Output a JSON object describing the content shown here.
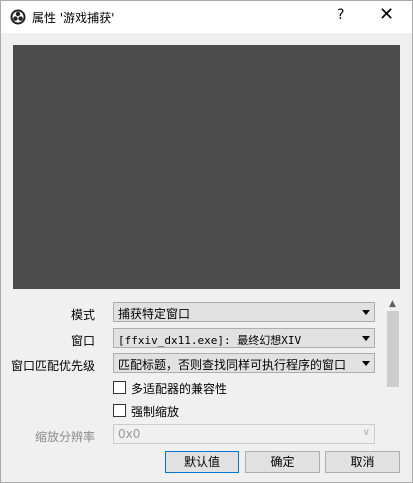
{
  "window": {
    "title": "属性 '游戏捕获'",
    "help_symbol": "?",
    "close_symbol": "✕",
    "icon": "obs-logo-icon"
  },
  "properties": {
    "mode": {
      "label": "模式",
      "value": "捕获特定窗口"
    },
    "window": {
      "label": "窗口",
      "value": "[ffxiv_dx11.exe]: 最终幻想XIV"
    },
    "match_priority": {
      "label": "窗口匹配优先级",
      "value": "匹配标题，否则查找同样可执行程序的窗口"
    },
    "multi_adapter": {
      "label": "多适配器的兼容性",
      "checked": false
    },
    "force_scaling": {
      "label": "强制缩放",
      "checked": false
    },
    "scale_resolution": {
      "label": "缩放分辨率",
      "value": "0x0",
      "enabled": false
    }
  },
  "buttons": {
    "defaults": "默认值",
    "ok": "确定",
    "cancel": "取消"
  },
  "colors": {
    "preview_bg": "#4c4c4c",
    "focus_border": "#0078d7"
  }
}
